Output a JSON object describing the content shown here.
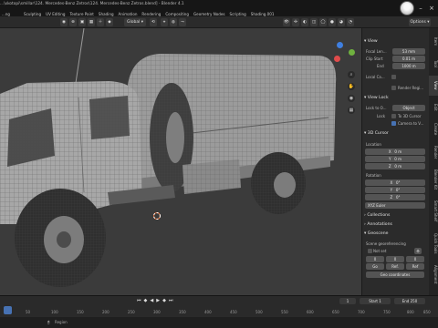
{
  "window": {
    "title": "...\\xkotopi\\smillar\\124. Mercedes-Benz Zetros\\124. Mercedes-Benz Zetros.blend] - Blender 4.1"
  },
  "menus": [
    "Sculpting",
    "UV Editing",
    "Texture Paint",
    "Shading",
    "Animation",
    "Rendering",
    "Compositing",
    "Geometry Nodes",
    "Scripting",
    "Shading.001"
  ],
  "left_menu": "...ng",
  "header": {
    "global_label": "Global",
    "options_label": "Options"
  },
  "npanel": {
    "view": {
      "title": "View",
      "focal_length_label": "Focal Len...",
      "focal_length_value": "53 mm",
      "clip_start_label": "Clip Start",
      "clip_start_value": "0.01 m",
      "clip_end_label": "End",
      "clip_end_value": "1000 m",
      "local_camera_label": "Local Ca...",
      "render_region_label": "Render Regi..."
    },
    "view_lock": {
      "title": "View Lock",
      "lock_to_label": "Lock to O...",
      "lock_object_value": "Object",
      "lock_label": "Lock",
      "to_3d_cursor_label": "To 3D Cursor",
      "camera_to_view_label": "Camera to V..."
    },
    "cursor": {
      "title": "3D Cursor",
      "location_label": "Location",
      "x_label": "X",
      "x_value": "0 m",
      "y_label": "Y",
      "y_value": "0 m",
      "z_label": "Z",
      "z_value": "0 m",
      "rotation_label": "Rotation",
      "rx_label": "X",
      "rx_value": "0°",
      "ry_label": "Y",
      "ry_value": "0°",
      "rz_label": "Z",
      "rz_value": "0°",
      "mode_value": "XYZ Euler"
    },
    "collections_label": "Collections",
    "annotations_label": "Annotations",
    "geoscene_label": "Geoscene",
    "scene_geo_label": "Scene georeferencing",
    "not_set_label": "Not set",
    "geo_x_value": "0",
    "geo_y_value": "0",
    "geo_z_value": "0",
    "geo_btn1": "Go",
    "geo_btn2": "Ref.",
    "geo_btn3": "Ref",
    "geo_coords_btn": "Geo coordinates"
  },
  "tabs": [
    "Item",
    "Tool",
    "View",
    "Edit",
    "Create",
    "Render",
    "Blender Kit",
    "Smart Shelf",
    "Quick Tools",
    "Alignment"
  ],
  "timeline": {
    "ticks": [
      "50",
      "100",
      "150",
      "200",
      "250",
      "300",
      "350",
      "400",
      "450",
      "500",
      "550",
      "600",
      "650",
      "700",
      "750",
      "800",
      "850"
    ],
    "current_frame": "1",
    "start_label": "Start",
    "start_value": "1",
    "end_label": "End",
    "end_value": "250"
  },
  "status": {
    "region_label": "Region"
  },
  "colors": {
    "accent": "#4772b3",
    "viewport_bg": "#3b3b3b",
    "panel_bg": "#2b2b2b",
    "gizmo_x": "#e04b4b",
    "gizmo_y": "#6fb13f",
    "gizmo_z": "#3f7fe0"
  }
}
